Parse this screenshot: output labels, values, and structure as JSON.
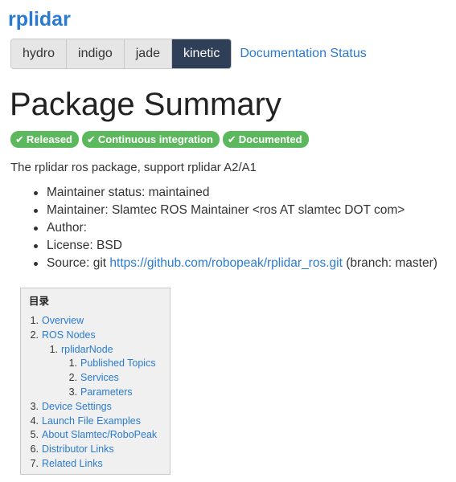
{
  "package": {
    "name": "rplidar"
  },
  "distros": {
    "items": [
      {
        "label": "hydro",
        "active": false
      },
      {
        "label": "indigo",
        "active": false
      },
      {
        "label": "jade",
        "active": false
      },
      {
        "label": "kinetic",
        "active": true
      }
    ],
    "doc_status_label": "Documentation Status"
  },
  "summary": {
    "title": "Package Summary",
    "badges": [
      {
        "label": "Released",
        "icon": "check-icon"
      },
      {
        "label": "Continuous integration",
        "icon": "check-icon"
      },
      {
        "label": "Documented",
        "icon": "check-icon"
      }
    ],
    "description": "The rplidar ros package, support rplidar A2/A1",
    "info": {
      "maintainer_status": "Maintainer status: maintained",
      "maintainer": "Maintainer: Slamtec ROS Maintainer <ros AT slamtec DOT com>",
      "author": "Author:",
      "license": "License: BSD",
      "source_prefix": "Source: git ",
      "source_link": "https://github.com/robopeak/rplidar_ros.git",
      "source_suffix": " (branch: master)"
    }
  },
  "toc": {
    "title": "目录",
    "items": [
      {
        "num": "1.",
        "label": "Overview"
      },
      {
        "num": "2.",
        "label": "ROS Nodes"
      },
      {
        "num": "1.",
        "label": "rplidarNode"
      },
      {
        "num": "1.",
        "label": "Published Topics"
      },
      {
        "num": "2.",
        "label": "Services"
      },
      {
        "num": "3.",
        "label": "Parameters"
      },
      {
        "num": "3.",
        "label": "Device Settings"
      },
      {
        "num": "4.",
        "label": "Launch File Examples"
      },
      {
        "num": "5.",
        "label": "About Slamtec/RoboPeak"
      },
      {
        "num": "6.",
        "label": "Distributor Links"
      },
      {
        "num": "7.",
        "label": "Related Links"
      }
    ]
  },
  "colors": {
    "link": "#2a7bd0",
    "active_distro": "#2e3f57",
    "badge_green": "#5cb85c"
  }
}
